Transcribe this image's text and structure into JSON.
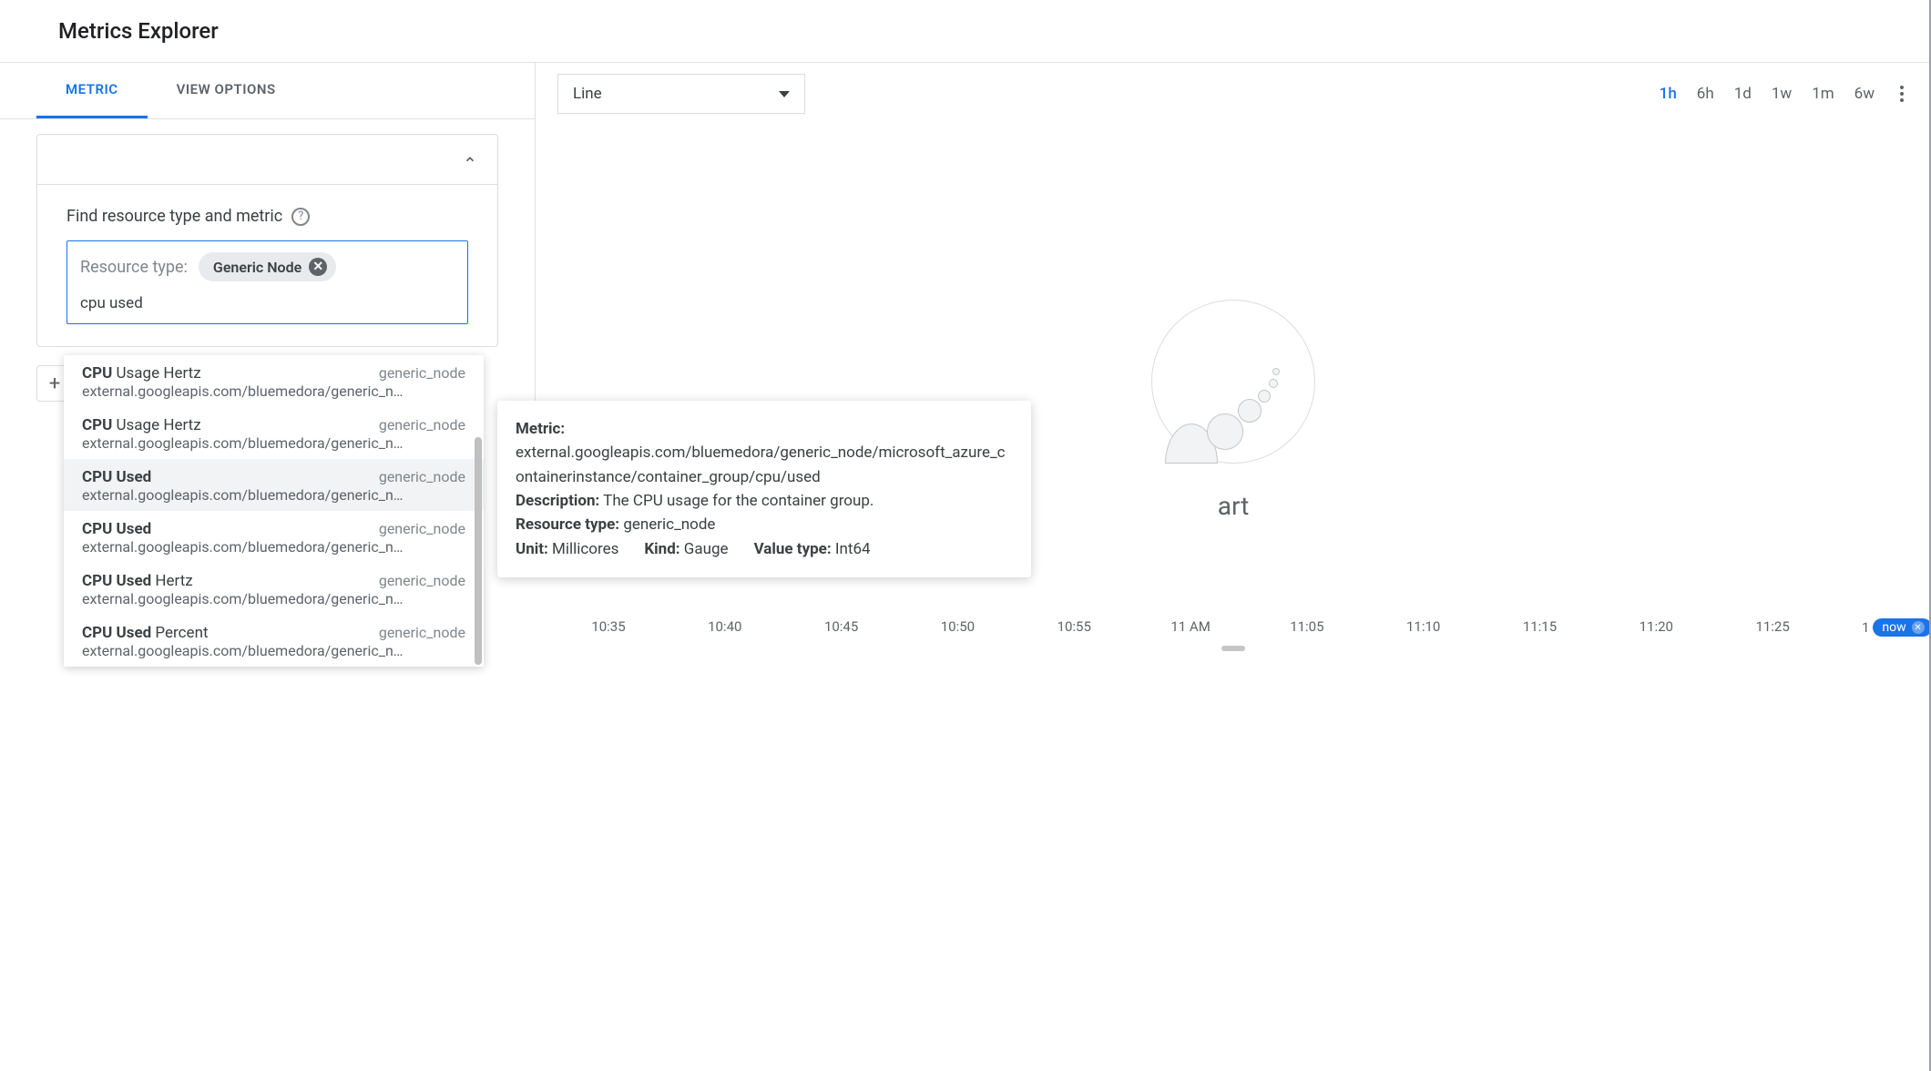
{
  "header": {
    "title": "Metrics Explorer"
  },
  "tabs": {
    "metric": "METRIC",
    "view_options": "VIEW OPTIONS"
  },
  "search": {
    "label": "Find resource type and metric",
    "resource_type_label": "Resource type:",
    "chip": "Generic Node",
    "query": "cpu used"
  },
  "add_button": "+",
  "suggestions": [
    {
      "bold": "CPU",
      "rest": " Usage Hertz",
      "resource": "generic_node",
      "path": "external.googleapis.com/bluemedora/generic_n…",
      "selected": false
    },
    {
      "bold": "CPU",
      "rest": " Usage Hertz",
      "resource": "generic_node",
      "path": "external.googleapis.com/bluemedora/generic_n…",
      "selected": false
    },
    {
      "bold": "CPU Used",
      "rest": "",
      "resource": "generic_node",
      "path": "external.googleapis.com/bluemedora/generic_n…",
      "selected": true
    },
    {
      "bold": "CPU Used",
      "rest": "",
      "resource": "generic_node",
      "path": "external.googleapis.com/bluemedora/generic_n…",
      "selected": false
    },
    {
      "bold": "CPU Used",
      "rest": " Hertz",
      "resource": "generic_node",
      "path": "external.googleapis.com/bluemedora/generic_n…",
      "selected": false
    },
    {
      "bold": "CPU Used",
      "rest": " Percent",
      "resource": "generic_node",
      "path": "external.googleapis.com/bluemedora/generic_n…",
      "selected": false
    }
  ],
  "chart_type": {
    "selected": "Line"
  },
  "time_range": [
    "1h",
    "6h",
    "1d",
    "1w",
    "1m",
    "6w"
  ],
  "time_range_active": "1h",
  "tooltip": {
    "metric_label": "Metric:",
    "metric_path": "external.googleapis.com/bluemedora/generic_node/microsoft_azure_containerinstance/container_group/cpu/used",
    "description_label": "Description:",
    "description": "The CPU usage for the container group.",
    "resource_type_label": "Resource type:",
    "resource_type": "generic_node",
    "unit_label": "Unit:",
    "unit": "Millicores",
    "kind_label": "Kind:",
    "kind": "Gauge",
    "value_type_label": "Value type:",
    "value_type": "Int64"
  },
  "chart_title_visible": "art",
  "xaxis": [
    "10:35",
    "10:40",
    "10:45",
    "10:50",
    "10:55",
    "11 AM",
    "11:05",
    "11:10",
    "11:15",
    "11:20",
    "11:25",
    "1"
  ],
  "now_label": "now"
}
